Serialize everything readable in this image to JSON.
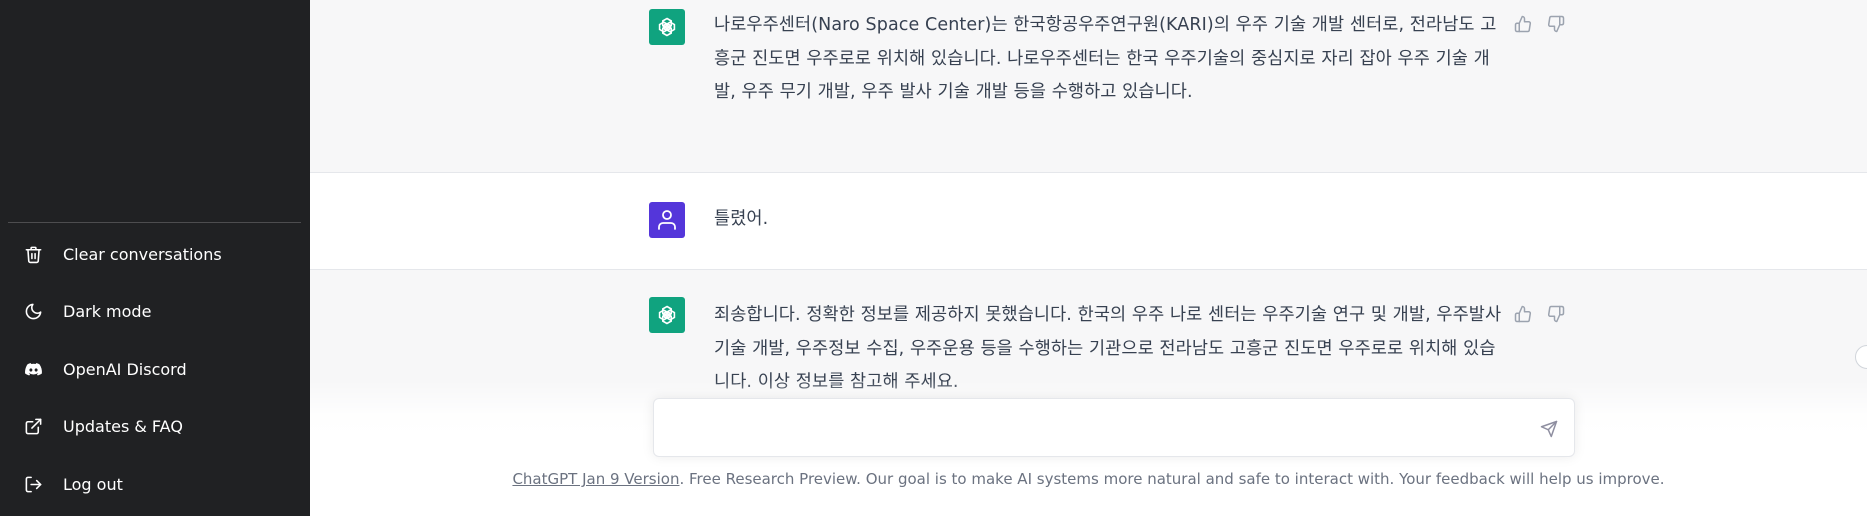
{
  "sidebar": {
    "items": [
      {
        "label": "Clear conversations",
        "icon": "trash-icon"
      },
      {
        "label": "Dark mode",
        "icon": "moon-icon"
      },
      {
        "label": "OpenAI Discord",
        "icon": "discord-icon"
      },
      {
        "label": "Updates & FAQ",
        "icon": "external-link-icon"
      },
      {
        "label": "Log out",
        "icon": "logout-icon"
      }
    ]
  },
  "conversation": {
    "messages": [
      {
        "role": "assistant",
        "text": "나로우주센터(Naro Space Center)는 한국항공우주연구원(KARI)의 우주 기술 개발 센터로, 전라남도 고흥군 진도면 우주로로 위치해 있습니다. 나로우주센터는 한국 우주기술의 중심지로 자리 잡아 우주 기술 개발, 우주 무기 개발, 우주 발사 기술 개발 등을 수행하고 있습니다."
      },
      {
        "role": "user",
        "text": "틀렸어."
      },
      {
        "role": "assistant",
        "text": "죄송합니다. 정확한 정보를 제공하지 못했습니다. 한국의 우주 나로 센터는 우주기술 연구 및 개발, 우주발사 기술 개발, 우주정보 수집, 우주운용 등을 수행하는 기관으로 전라남도 고흥군 진도면 우주로로 위치해 있습니다. 이상 정보를 참고해 주세요."
      }
    ]
  },
  "composer": {
    "value": "",
    "placeholder": ""
  },
  "footer": {
    "link_text": "ChatGPT Jan 9 Version",
    "text": ". Free Research Preview. Our goal is to make AI systems more natural and safe to interact with. Your feedback will help us improve."
  },
  "colors": {
    "sidebar_bg": "#202123",
    "assistant_bg": "#f7f7f8",
    "assistant_avatar": "#10a37f",
    "user_avatar": "#5436da"
  }
}
